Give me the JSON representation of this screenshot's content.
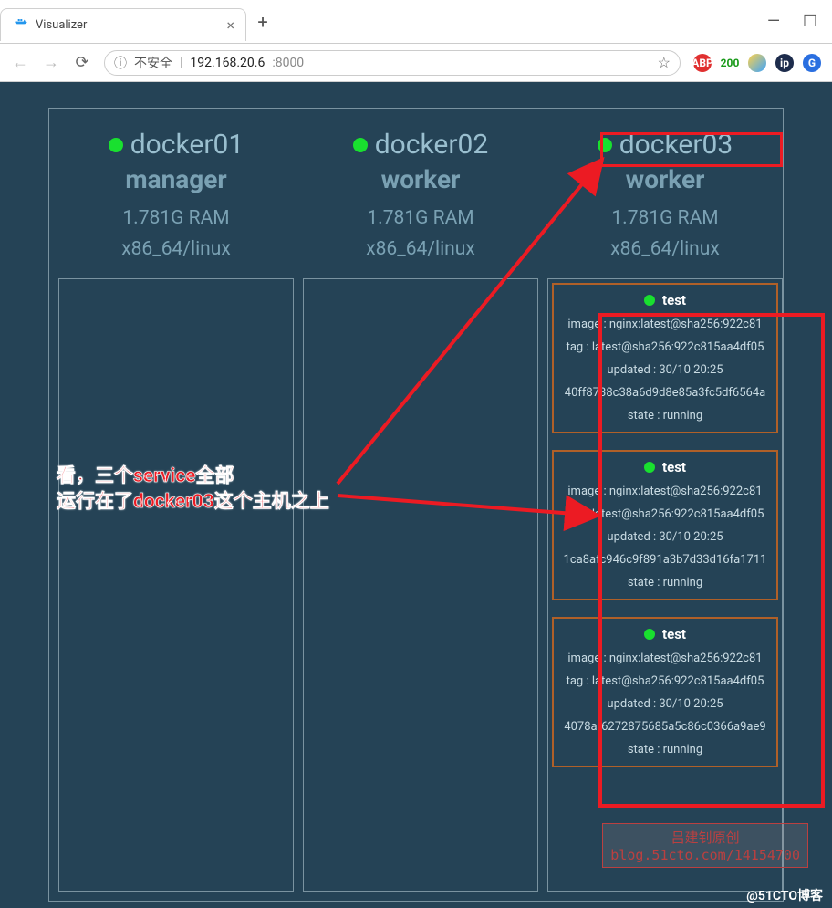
{
  "browser": {
    "tab_title": "Visualizer",
    "url_warn": "不安全",
    "url_host": "192.168.20.6",
    "url_port": ":8000",
    "badge_text": "200",
    "abp_label": "ABP",
    "ip_label": "ip",
    "g_label": "G"
  },
  "nodes": [
    {
      "name": "docker01",
      "role": "manager",
      "ram": "1.781G RAM",
      "arch": "x86_64/linux",
      "services": []
    },
    {
      "name": "docker02",
      "role": "worker",
      "ram": "1.781G RAM",
      "arch": "x86_64/linux",
      "services": []
    },
    {
      "name": "docker03",
      "role": "worker",
      "ram": "1.781G RAM",
      "arch": "x86_64/linux",
      "services": [
        {
          "title": "test",
          "image": "image : nginx:latest@sha256:922c81",
          "tag": "tag : latest@sha256:922c815aa4df05",
          "updated": "updated : 30/10 20:25",
          "id": "40ff8738c38a6d9d8e85a3fc5df6564a",
          "state": "state : running"
        },
        {
          "title": "test",
          "image": "image : nginx:latest@sha256:922c81",
          "tag": "tag : latest@sha256:922c815aa4df05",
          "updated": "updated : 30/10 20:25",
          "id": "1ca8afc946c9f891a3b7d33d16fa1711",
          "state": "state : running"
        },
        {
          "title": "test",
          "image": "image : nginx:latest@sha256:922c81",
          "tag": "tag : latest@sha256:922c815aa4df05",
          "updated": "updated : 30/10 20:25",
          "id": "4078af6272875685a5c86c0366a9ae9",
          "state": "state : running"
        }
      ]
    }
  ],
  "annotation": {
    "line1": "看，三个service全部",
    "line2": "运行在了docker03这个主机之上"
  },
  "watermark": {
    "line1": "吕建钊原创",
    "line2": "blog.51cto.com/14154700",
    "corner": "@51CTO博客"
  }
}
